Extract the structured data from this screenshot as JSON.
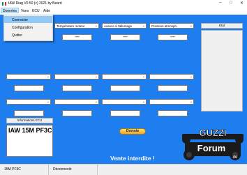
{
  "window": {
    "title": "IAW Diag V0.50  (c) 2021 by Beard"
  },
  "menu": [
    "Données",
    "Vues",
    "ECU",
    "Aide"
  ],
  "dropdown": [
    "Connecter",
    "Configuration",
    "Quitter"
  ],
  "selectors": {
    "row1": [
      "",
      "Température moteur",
      "Avance à l'allumage",
      "Pression atmosph."
    ],
    "row2": [
      "",
      "",
      "",
      ""
    ],
    "row3": [
      "",
      "",
      "",
      ""
    ]
  },
  "displays": {
    "row1": [
      "----",
      "----",
      "----"
    ],
    "row2": [
      "",
      "",
      "",
      ""
    ],
    "row3": [
      "",
      "",
      "",
      ""
    ]
  },
  "buttons": {
    "etat": "Etat",
    "ecu_info": "Informations ECU",
    "donate": "Donate"
  },
  "ecu": {
    "name": "IAW 15M PF3C"
  },
  "notice": "Vente interdite !",
  "logo": {
    "line1": "GUZZI",
    "line2": "Forum",
    "suffix": ".de"
  },
  "status": {
    "ecu": "15M PF3C",
    "connection": "Déconnecté"
  },
  "colors": {
    "background": "#1e7ef0",
    "highlight": "#91c9f7"
  }
}
